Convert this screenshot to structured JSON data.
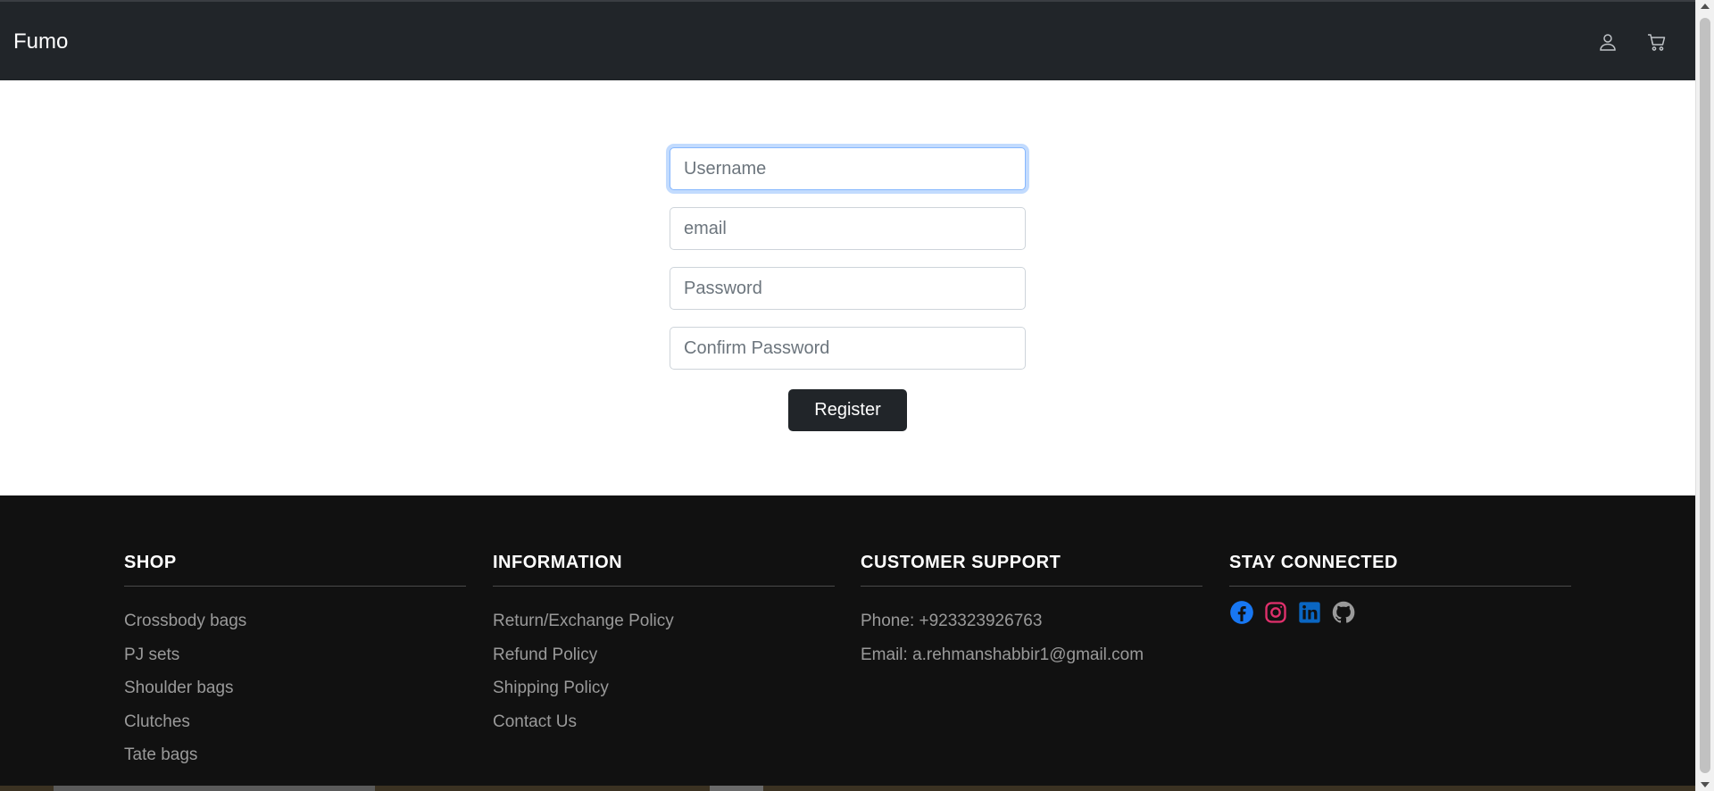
{
  "navbar": {
    "brand": "Fumo",
    "icons": [
      "user-icon",
      "cart-icon"
    ]
  },
  "form": {
    "username": {
      "placeholder": "Username",
      "value": ""
    },
    "email": {
      "placeholder": "email",
      "value": ""
    },
    "password": {
      "placeholder": "Password",
      "value": ""
    },
    "confirm_password": {
      "placeholder": "Confirm Password",
      "value": ""
    },
    "register_label": "Register"
  },
  "footer": {
    "shop": {
      "title": "SHOP",
      "items": [
        "Crossbody bags",
        "PJ sets",
        "Shoulder bags",
        "Clutches",
        "Tate bags"
      ]
    },
    "information": {
      "title": "INFORMATION",
      "items": [
        "Return/Exchange Policy",
        "Refund Policy",
        "Shipping Policy",
        "Contact Us"
      ]
    },
    "support": {
      "title": "CUSTOMER SUPPORT",
      "phone": "Phone: +923323926763",
      "email": "Email: a.rehmanshabbir1@gmail.com"
    },
    "connected": {
      "title": "STAY CONNECTED",
      "icons": [
        "facebook-icon",
        "instagram-icon",
        "linkedin-icon",
        "github-icon"
      ]
    }
  },
  "colors": {
    "navbar_bg": "#212529",
    "footer_bg": "#111111",
    "button_bg": "#212529",
    "focus_border": "#86b7fe",
    "facebook": "#1877f2",
    "instagram": "#e1306c",
    "linkedin": "#0a66c2",
    "github": "#9a9a9a"
  }
}
